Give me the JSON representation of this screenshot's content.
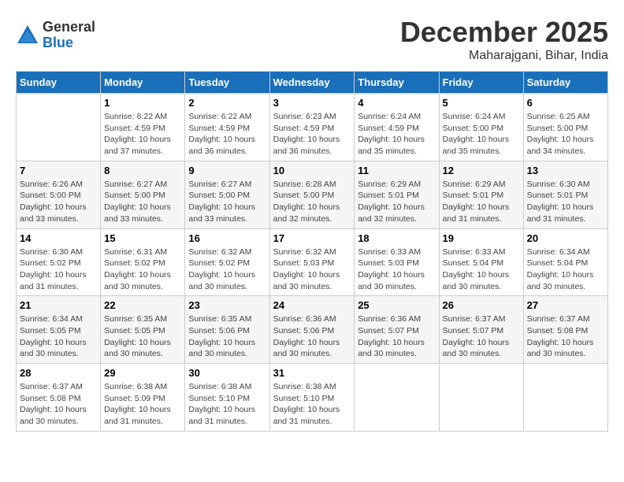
{
  "header": {
    "logo_general": "General",
    "logo_blue": "Blue",
    "title": "December 2025",
    "location": "Maharajgani, Bihar, India"
  },
  "weekdays": [
    "Sunday",
    "Monday",
    "Tuesday",
    "Wednesday",
    "Thursday",
    "Friday",
    "Saturday"
  ],
  "weeks": [
    [
      {
        "day": "",
        "sunrise": "",
        "sunset": "",
        "daylight": ""
      },
      {
        "day": "1",
        "sunrise": "Sunrise: 6:22 AM",
        "sunset": "Sunset: 4:59 PM",
        "daylight": "Daylight: 10 hours and 37 minutes."
      },
      {
        "day": "2",
        "sunrise": "Sunrise: 6:22 AM",
        "sunset": "Sunset: 4:59 PM",
        "daylight": "Daylight: 10 hours and 36 minutes."
      },
      {
        "day": "3",
        "sunrise": "Sunrise: 6:23 AM",
        "sunset": "Sunset: 4:59 PM",
        "daylight": "Daylight: 10 hours and 36 minutes."
      },
      {
        "day": "4",
        "sunrise": "Sunrise: 6:24 AM",
        "sunset": "Sunset: 4:59 PM",
        "daylight": "Daylight: 10 hours and 35 minutes."
      },
      {
        "day": "5",
        "sunrise": "Sunrise: 6:24 AM",
        "sunset": "Sunset: 5:00 PM",
        "daylight": "Daylight: 10 hours and 35 minutes."
      },
      {
        "day": "6",
        "sunrise": "Sunrise: 6:25 AM",
        "sunset": "Sunset: 5:00 PM",
        "daylight": "Daylight: 10 hours and 34 minutes."
      }
    ],
    [
      {
        "day": "7",
        "sunrise": "Sunrise: 6:26 AM",
        "sunset": "Sunset: 5:00 PM",
        "daylight": "Daylight: 10 hours and 33 minutes."
      },
      {
        "day": "8",
        "sunrise": "Sunrise: 6:27 AM",
        "sunset": "Sunset: 5:00 PM",
        "daylight": "Daylight: 10 hours and 33 minutes."
      },
      {
        "day": "9",
        "sunrise": "Sunrise: 6:27 AM",
        "sunset": "Sunset: 5:00 PM",
        "daylight": "Daylight: 10 hours and 33 minutes."
      },
      {
        "day": "10",
        "sunrise": "Sunrise: 6:28 AM",
        "sunset": "Sunset: 5:00 PM",
        "daylight": "Daylight: 10 hours and 32 minutes."
      },
      {
        "day": "11",
        "sunrise": "Sunrise: 6:29 AM",
        "sunset": "Sunset: 5:01 PM",
        "daylight": "Daylight: 10 hours and 32 minutes."
      },
      {
        "day": "12",
        "sunrise": "Sunrise: 6:29 AM",
        "sunset": "Sunset: 5:01 PM",
        "daylight": "Daylight: 10 hours and 31 minutes."
      },
      {
        "day": "13",
        "sunrise": "Sunrise: 6:30 AM",
        "sunset": "Sunset: 5:01 PM",
        "daylight": "Daylight: 10 hours and 31 minutes."
      }
    ],
    [
      {
        "day": "14",
        "sunrise": "Sunrise: 6:30 AM",
        "sunset": "Sunset: 5:02 PM",
        "daylight": "Daylight: 10 hours and 31 minutes."
      },
      {
        "day": "15",
        "sunrise": "Sunrise: 6:31 AM",
        "sunset": "Sunset: 5:02 PM",
        "daylight": "Daylight: 10 hours and 30 minutes."
      },
      {
        "day": "16",
        "sunrise": "Sunrise: 6:32 AM",
        "sunset": "Sunset: 5:02 PM",
        "daylight": "Daylight: 10 hours and 30 minutes."
      },
      {
        "day": "17",
        "sunrise": "Sunrise: 6:32 AM",
        "sunset": "Sunset: 5:03 PM",
        "daylight": "Daylight: 10 hours and 30 minutes."
      },
      {
        "day": "18",
        "sunrise": "Sunrise: 6:33 AM",
        "sunset": "Sunset: 5:03 PM",
        "daylight": "Daylight: 10 hours and 30 minutes."
      },
      {
        "day": "19",
        "sunrise": "Sunrise: 6:33 AM",
        "sunset": "Sunset: 5:04 PM",
        "daylight": "Daylight: 10 hours and 30 minutes."
      },
      {
        "day": "20",
        "sunrise": "Sunrise: 6:34 AM",
        "sunset": "Sunset: 5:04 PM",
        "daylight": "Daylight: 10 hours and 30 minutes."
      }
    ],
    [
      {
        "day": "21",
        "sunrise": "Sunrise: 6:34 AM",
        "sunset": "Sunset: 5:05 PM",
        "daylight": "Daylight: 10 hours and 30 minutes."
      },
      {
        "day": "22",
        "sunrise": "Sunrise: 6:35 AM",
        "sunset": "Sunset: 5:05 PM",
        "daylight": "Daylight: 10 hours and 30 minutes."
      },
      {
        "day": "23",
        "sunrise": "Sunrise: 6:35 AM",
        "sunset": "Sunset: 5:06 PM",
        "daylight": "Daylight: 10 hours and 30 minutes."
      },
      {
        "day": "24",
        "sunrise": "Sunrise: 6:36 AM",
        "sunset": "Sunset: 5:06 PM",
        "daylight": "Daylight: 10 hours and 30 minutes."
      },
      {
        "day": "25",
        "sunrise": "Sunrise: 6:36 AM",
        "sunset": "Sunset: 5:07 PM",
        "daylight": "Daylight: 10 hours and 30 minutes."
      },
      {
        "day": "26",
        "sunrise": "Sunrise: 6:37 AM",
        "sunset": "Sunset: 5:07 PM",
        "daylight": "Daylight: 10 hours and 30 minutes."
      },
      {
        "day": "27",
        "sunrise": "Sunrise: 6:37 AM",
        "sunset": "Sunset: 5:08 PM",
        "daylight": "Daylight: 10 hours and 30 minutes."
      }
    ],
    [
      {
        "day": "28",
        "sunrise": "Sunrise: 6:37 AM",
        "sunset": "Sunset: 5:08 PM",
        "daylight": "Daylight: 10 hours and 30 minutes."
      },
      {
        "day": "29",
        "sunrise": "Sunrise: 6:38 AM",
        "sunset": "Sunset: 5:09 PM",
        "daylight": "Daylight: 10 hours and 31 minutes."
      },
      {
        "day": "30",
        "sunrise": "Sunrise: 6:38 AM",
        "sunset": "Sunset: 5:10 PM",
        "daylight": "Daylight: 10 hours and 31 minutes."
      },
      {
        "day": "31",
        "sunrise": "Sunrise: 6:38 AM",
        "sunset": "Sunset: 5:10 PM",
        "daylight": "Daylight: 10 hours and 31 minutes."
      },
      {
        "day": "",
        "sunrise": "",
        "sunset": "",
        "daylight": ""
      },
      {
        "day": "",
        "sunrise": "",
        "sunset": "",
        "daylight": ""
      },
      {
        "day": "",
        "sunrise": "",
        "sunset": "",
        "daylight": ""
      }
    ]
  ]
}
